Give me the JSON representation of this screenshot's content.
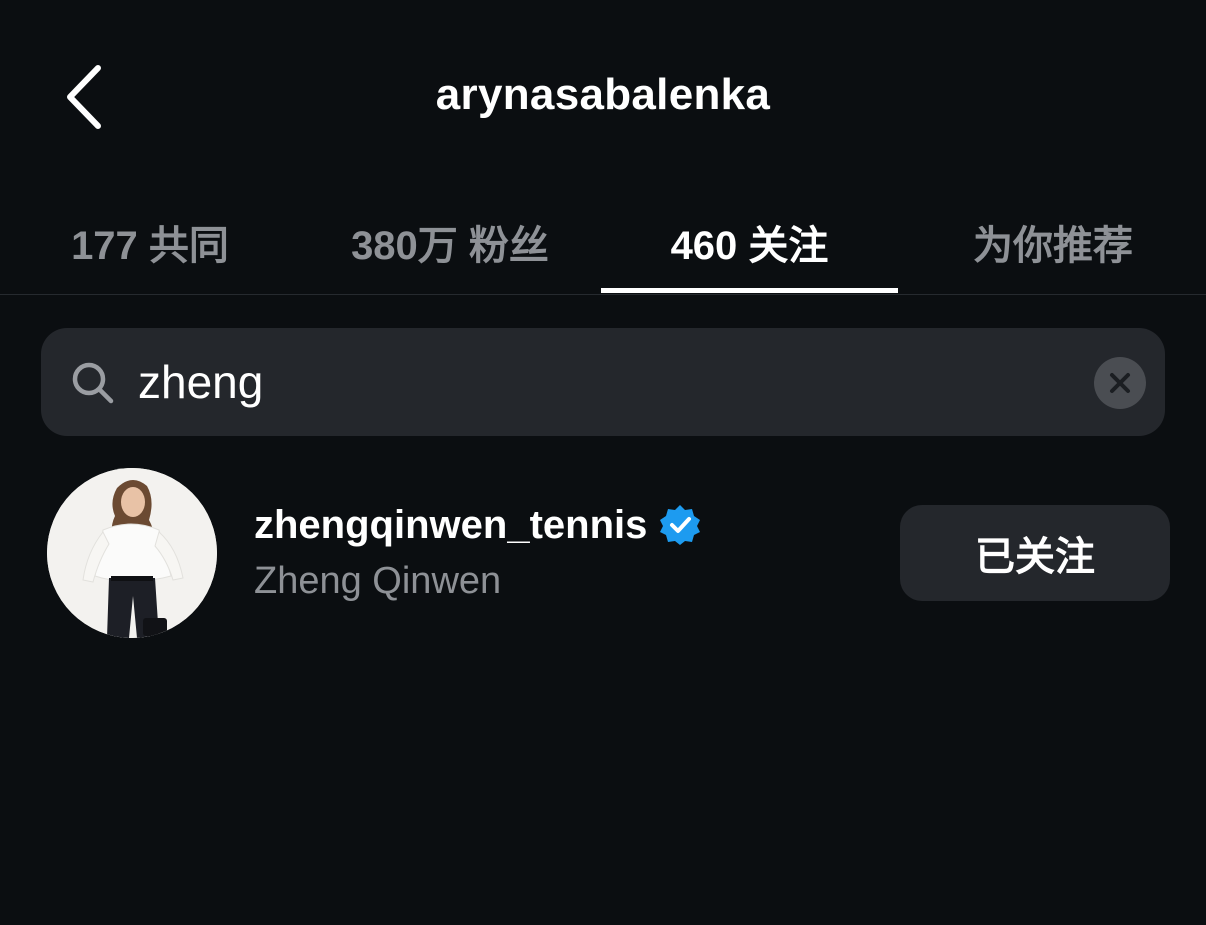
{
  "header": {
    "title": "arynasabalenka",
    "back_icon": "chevron-left-icon"
  },
  "tabs": [
    {
      "label": "177 共同",
      "active": false
    },
    {
      "label": "380万 粉丝",
      "active": false
    },
    {
      "label": "460 关注",
      "active": true
    },
    {
      "label": "为你推荐",
      "active": false
    }
  ],
  "search": {
    "value": "zheng",
    "icon": "search-icon",
    "clear_icon": "close-icon"
  },
  "results": [
    {
      "username": "zhengqinwen_tennis",
      "verified": true,
      "full_name": "Zheng Qinwen",
      "follow_label": "已关注"
    }
  ],
  "colors": {
    "background": "#0b0e11",
    "field": "#24272c",
    "secondary_text": "#8e9196",
    "verified_blue": "#1d9bf0"
  }
}
